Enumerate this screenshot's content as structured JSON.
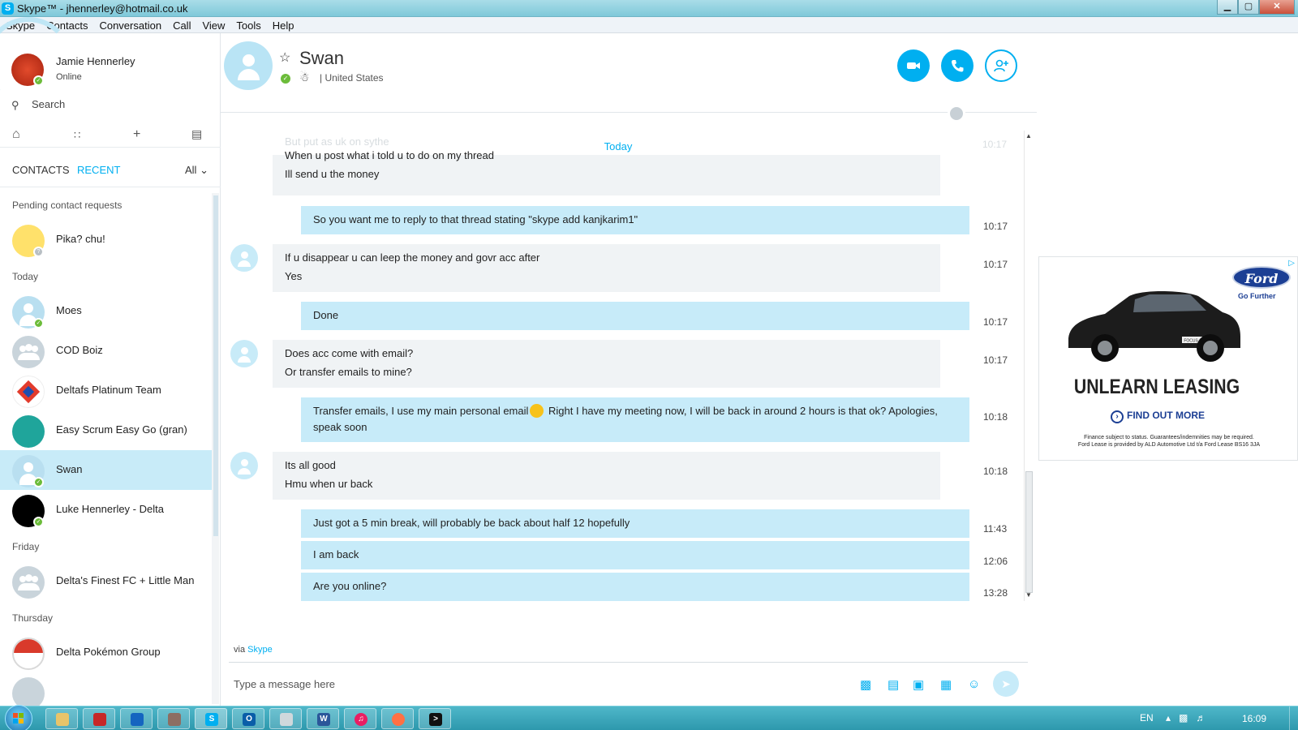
{
  "window": {
    "app_logo": "S",
    "title": "Skype™ - jhennerley@hotmail.co.uk",
    "minimize": "▁",
    "maximize": "▢",
    "close": "✕"
  },
  "menu": [
    "Skype",
    "Contacts",
    "Conversation",
    "Call",
    "View",
    "Tools",
    "Help"
  ],
  "profile": {
    "name": "Jamie Hennerley",
    "status": "Online"
  },
  "search": {
    "label": "Search"
  },
  "tabs": {
    "contacts": "CONTACTS",
    "recent": "RECENT",
    "filter": "All"
  },
  "sections": {
    "pending": "Pending contact requests",
    "today": "Today",
    "friday": "Friday",
    "thursday": "Thursday"
  },
  "contacts": {
    "pika": "Pika? chu!",
    "moes": "Moes",
    "cod": "COD Boiz",
    "deltafs": "Deltafs Platinum Team",
    "scrum": "Easy Scrum Easy Go (gran)",
    "swan": "Swan",
    "luke": "Luke Hennerley - Delta",
    "finest": "Delta's Finest FC + Little Man",
    "pokemon": "Delta Pokémon Group"
  },
  "conversation": {
    "name": "Swan",
    "location": "United States",
    "day_separator": "Today",
    "ghost_text": "But put as uk on sythe",
    "ghost_time": "10:17",
    "messages": [
      {
        "dir": "in",
        "lines": [
          "When u post what i told u to do on my thread",
          "Ill send u the money"
        ],
        "time": ""
      },
      {
        "dir": "out",
        "lines": [
          "So you want me to reply to that thread stating \"skype add kanjkarim1\""
        ],
        "time": "10:17"
      },
      {
        "dir": "in",
        "lines": [
          "If u disappear u can leep the money and govr acc after",
          "Yes"
        ],
        "time": "10:17"
      },
      {
        "dir": "out",
        "lines": [
          "Done"
        ],
        "time": "10:17"
      },
      {
        "dir": "in",
        "lines": [
          "Does acc come with email?",
          "Or transfer emails to mine?"
        ],
        "time": "10:17"
      },
      {
        "dir": "out",
        "lines": [
          "Transfer emails, I use my main personal email",
          "Right I have my meeting now, I will be back in around 2 hours is that ok? Apologies, speak soon"
        ],
        "time": "10:18"
      },
      {
        "dir": "in",
        "lines": [
          "Its all good",
          "Hmu when ur back"
        ],
        "time": "10:18"
      },
      {
        "dir": "out",
        "lines": [
          "Just got a 5 min break, will probably be back about half 12 hopefully"
        ],
        "time": "11:43"
      },
      {
        "dir": "out",
        "lines": [
          "I am back"
        ],
        "time": "12:06"
      },
      {
        "dir": "out",
        "lines": [
          "Are you online?"
        ],
        "time": "13:28"
      }
    ]
  },
  "composer": {
    "via_prefix": "via",
    "via_link": "Skype",
    "placeholder": "Type a message here"
  },
  "ad": {
    "brand": "Ford",
    "tagline": "Go Further",
    "model_badge": "FOCUS ST",
    "headline": "UNLEARN LEASING",
    "cta": "FIND OUT MORE",
    "fine_print_1": "Finance subject to status. Guarantees/indemnities may be required.",
    "fine_print_2": "Ford Lease is provided by ALD Automotive Ltd t/a Ford Lease BS16 3JA"
  },
  "taskbar": {
    "language": "EN",
    "clock": "16:09",
    "apps": [
      "file-explorer",
      "pdf-reader",
      "network",
      "paint",
      "skype",
      "outlook",
      "notepad",
      "word",
      "itunes",
      "firefox",
      "cmd"
    ]
  },
  "colors": {
    "accent": "#00aff0",
    "online": "#6cbc3a",
    "selected_row": "#c8ebf8",
    "outgoing_bubble": "#c7ebf9",
    "incoming_bubble": "#f0f3f5"
  }
}
